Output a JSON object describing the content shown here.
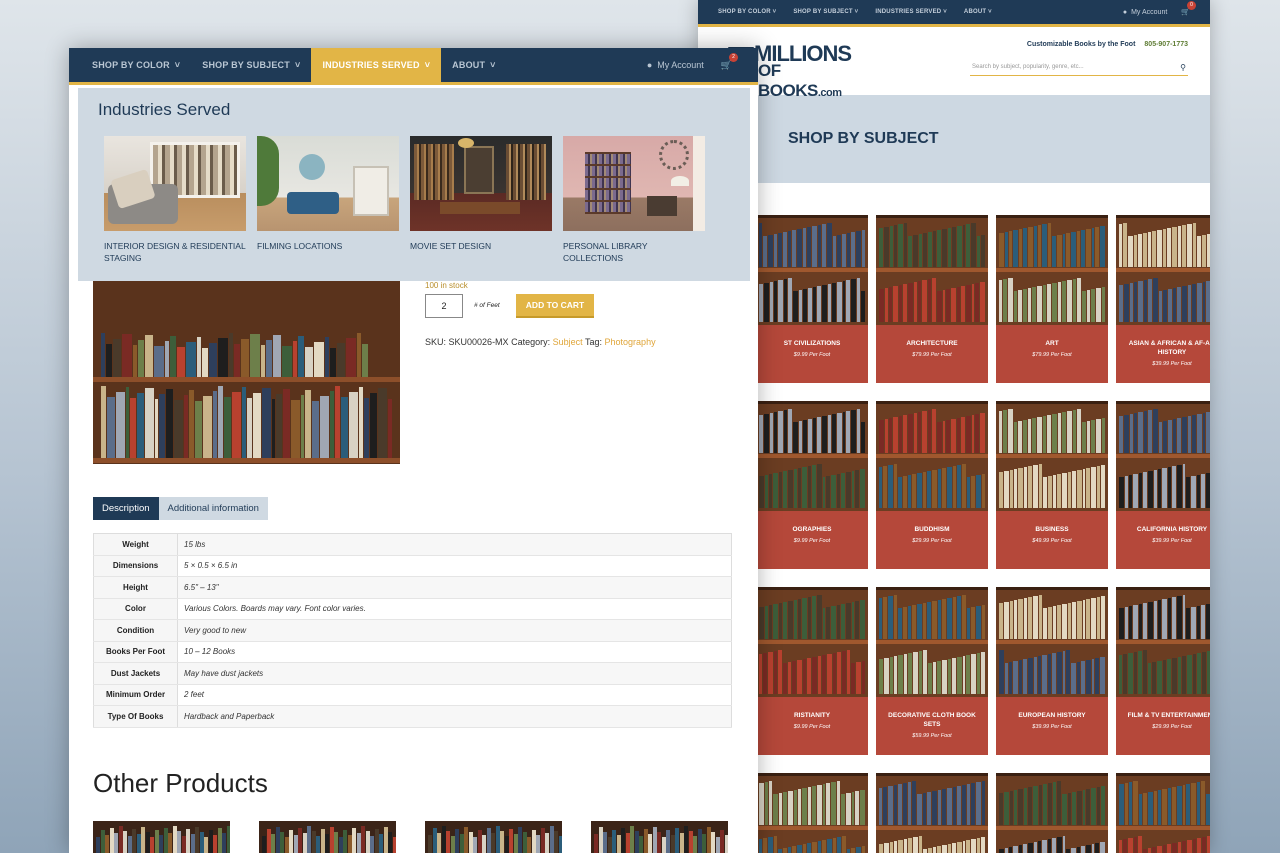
{
  "colors": {
    "navy": "#1f3a56",
    "gold": "#e2b546",
    "red": "#b5483a",
    "light_panel": "#cfd9e2"
  },
  "back": {
    "nav": [
      "SHOP BY COLOR",
      "SHOP BY SUBJECT",
      "INDUSTRIES SERVED",
      "ABOUT"
    ],
    "account": "My Account",
    "cart_count": "0",
    "logo_top": "MILLIONS",
    "logo_bottom": "OF BOOKS",
    "logo_com": ".com",
    "tagline": "Customizable Books by the Foot",
    "phone": "805-907-1773",
    "search_placeholder": "Search by subject, popularity, genre, etc...",
    "hero_title": "SHOP BY SUBJECT",
    "subjects": [
      {
        "name": "ST CIVILIZATIONS",
        "price": "$9.99 Per Foot"
      },
      {
        "name": "ARCHITECTURE",
        "price": "$79.99 Per Foot"
      },
      {
        "name": "ART",
        "price": "$79.99 Per Foot"
      },
      {
        "name": "ASIAN & AFRICAN & AF-AM HISTORY",
        "price": "$39.99 Per Foot"
      },
      {
        "name": "OGRAPHIES",
        "price": "$9.99 Per Foot"
      },
      {
        "name": "BUDDHISM",
        "price": "$29.99 Per Foot"
      },
      {
        "name": "BUSINESS",
        "price": "$49.99 Per Foot"
      },
      {
        "name": "CALIFORNIA HISTORY",
        "price": "$39.99 Per Foot"
      },
      {
        "name": "RISTIANITY",
        "price": "$9.99 Per Foot"
      },
      {
        "name": "DECORATIVE CLOTH BOOK SETS",
        "price": "$59.99 Per Foot"
      },
      {
        "name": "EUROPEAN HISTORY",
        "price": "$39.99 Per Foot"
      },
      {
        "name": "FILM & TV ENTERTAINMENT",
        "price": "$29.99 Per Foot"
      }
    ]
  },
  "front": {
    "nav": [
      {
        "label": "SHOP BY COLOR"
      },
      {
        "label": "SHOP BY SUBJECT"
      },
      {
        "label": "INDUSTRIES SERVED"
      },
      {
        "label": "ABOUT"
      }
    ],
    "account": "My Account",
    "cart_count": "2",
    "mega_title": "Industries Served",
    "industries": [
      {
        "label": "INTERIOR DESIGN & RESIDENTIAL STAGING"
      },
      {
        "label": "FILMING LOCATIONS"
      },
      {
        "label": "MOVIE SET DESIGN"
      },
      {
        "label": "PERSONAL LIBRARY COLLECTIONS"
      }
    ],
    "stock": "100 in stock",
    "qty": "2",
    "qty_label": "# of Feet",
    "add_to_cart": "ADD TO CART",
    "sku_label": "SKU:",
    "sku": "SKU00026-MX",
    "category_label": "Category:",
    "category": "Subject",
    "tag_label": "Tag:",
    "tag": "Photography",
    "tabs": [
      "Description",
      "Additional information"
    ],
    "specs": [
      {
        "k": "Weight",
        "v": "15 lbs"
      },
      {
        "k": "Dimensions",
        "v": "5 × 0.5 × 6.5 in"
      },
      {
        "k": "Height",
        "v": "6.5\" – 13\""
      },
      {
        "k": "Color",
        "v": "Various Colors. Boards may vary. Font color varies."
      },
      {
        "k": "Condition",
        "v": "Very good to new"
      },
      {
        "k": "Books Per Foot",
        "v": "10 – 12 Books"
      },
      {
        "k": "Dust Jackets",
        "v": "May have dust jackets"
      },
      {
        "k": "Minimum Order",
        "v": "2 feet"
      },
      {
        "k": "Type Of Books",
        "v": "Hardback and Paperback"
      }
    ],
    "other_products": "Other Products"
  }
}
